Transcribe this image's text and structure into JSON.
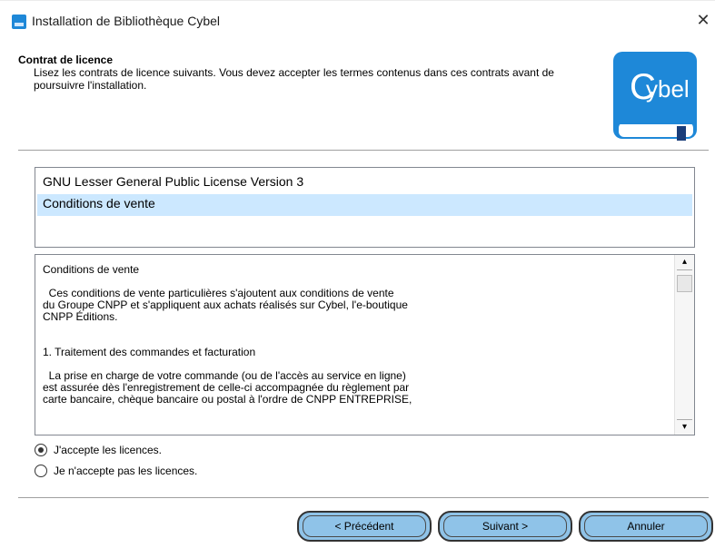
{
  "window": {
    "title": "Installation de Bibliothèque Cybel",
    "close_glyph": "✕"
  },
  "header": {
    "title": "Contrat de licence",
    "description": "Lisez les contrats de licence suivants. Vous devez accepter les termes contenus dans ces contrats avant de poursuivre l'installation.",
    "logo_text": "ybel",
    "logo_c": "C"
  },
  "license_list": {
    "items": [
      {
        "label": "GNU Lesser General Public License Version 3",
        "selected": false
      },
      {
        "label": "Conditions de vente",
        "selected": true
      }
    ]
  },
  "license_text": {
    "heading": "Conditions de vente",
    "paragraphs": [
      "  Ces conditions de vente particulières s'ajoutent aux conditions de vente\ndu Groupe CNPP et s'appliquent aux achats réalisés sur Cybel, l'e-boutique\nCNPP Éditions.",
      "1. Traitement des commandes et facturation",
      "  La prise en charge de votre commande (ou de l'accès au service en ligne)\nest assurée dès l'enregistrement de celle-ci accompagnée du règlement par\ncarte bancaire, chèque bancaire ou postal à l'ordre de CNPP ENTREPRISE,"
    ],
    "scroll_up_glyph": "▴",
    "scroll_down_glyph": "▾"
  },
  "radios": {
    "accept": {
      "label": "J'accepte les licences.",
      "checked": true
    },
    "decline": {
      "label": "Je n'accepte pas les licences.",
      "checked": false
    }
  },
  "buttons": {
    "previous": "< Précédent",
    "next": "Suivant >",
    "cancel": "Annuler"
  },
  "colors": {
    "button_fill": "#8fc3e8",
    "selection": "#cce8ff",
    "logo_blue": "#1e88d8"
  }
}
